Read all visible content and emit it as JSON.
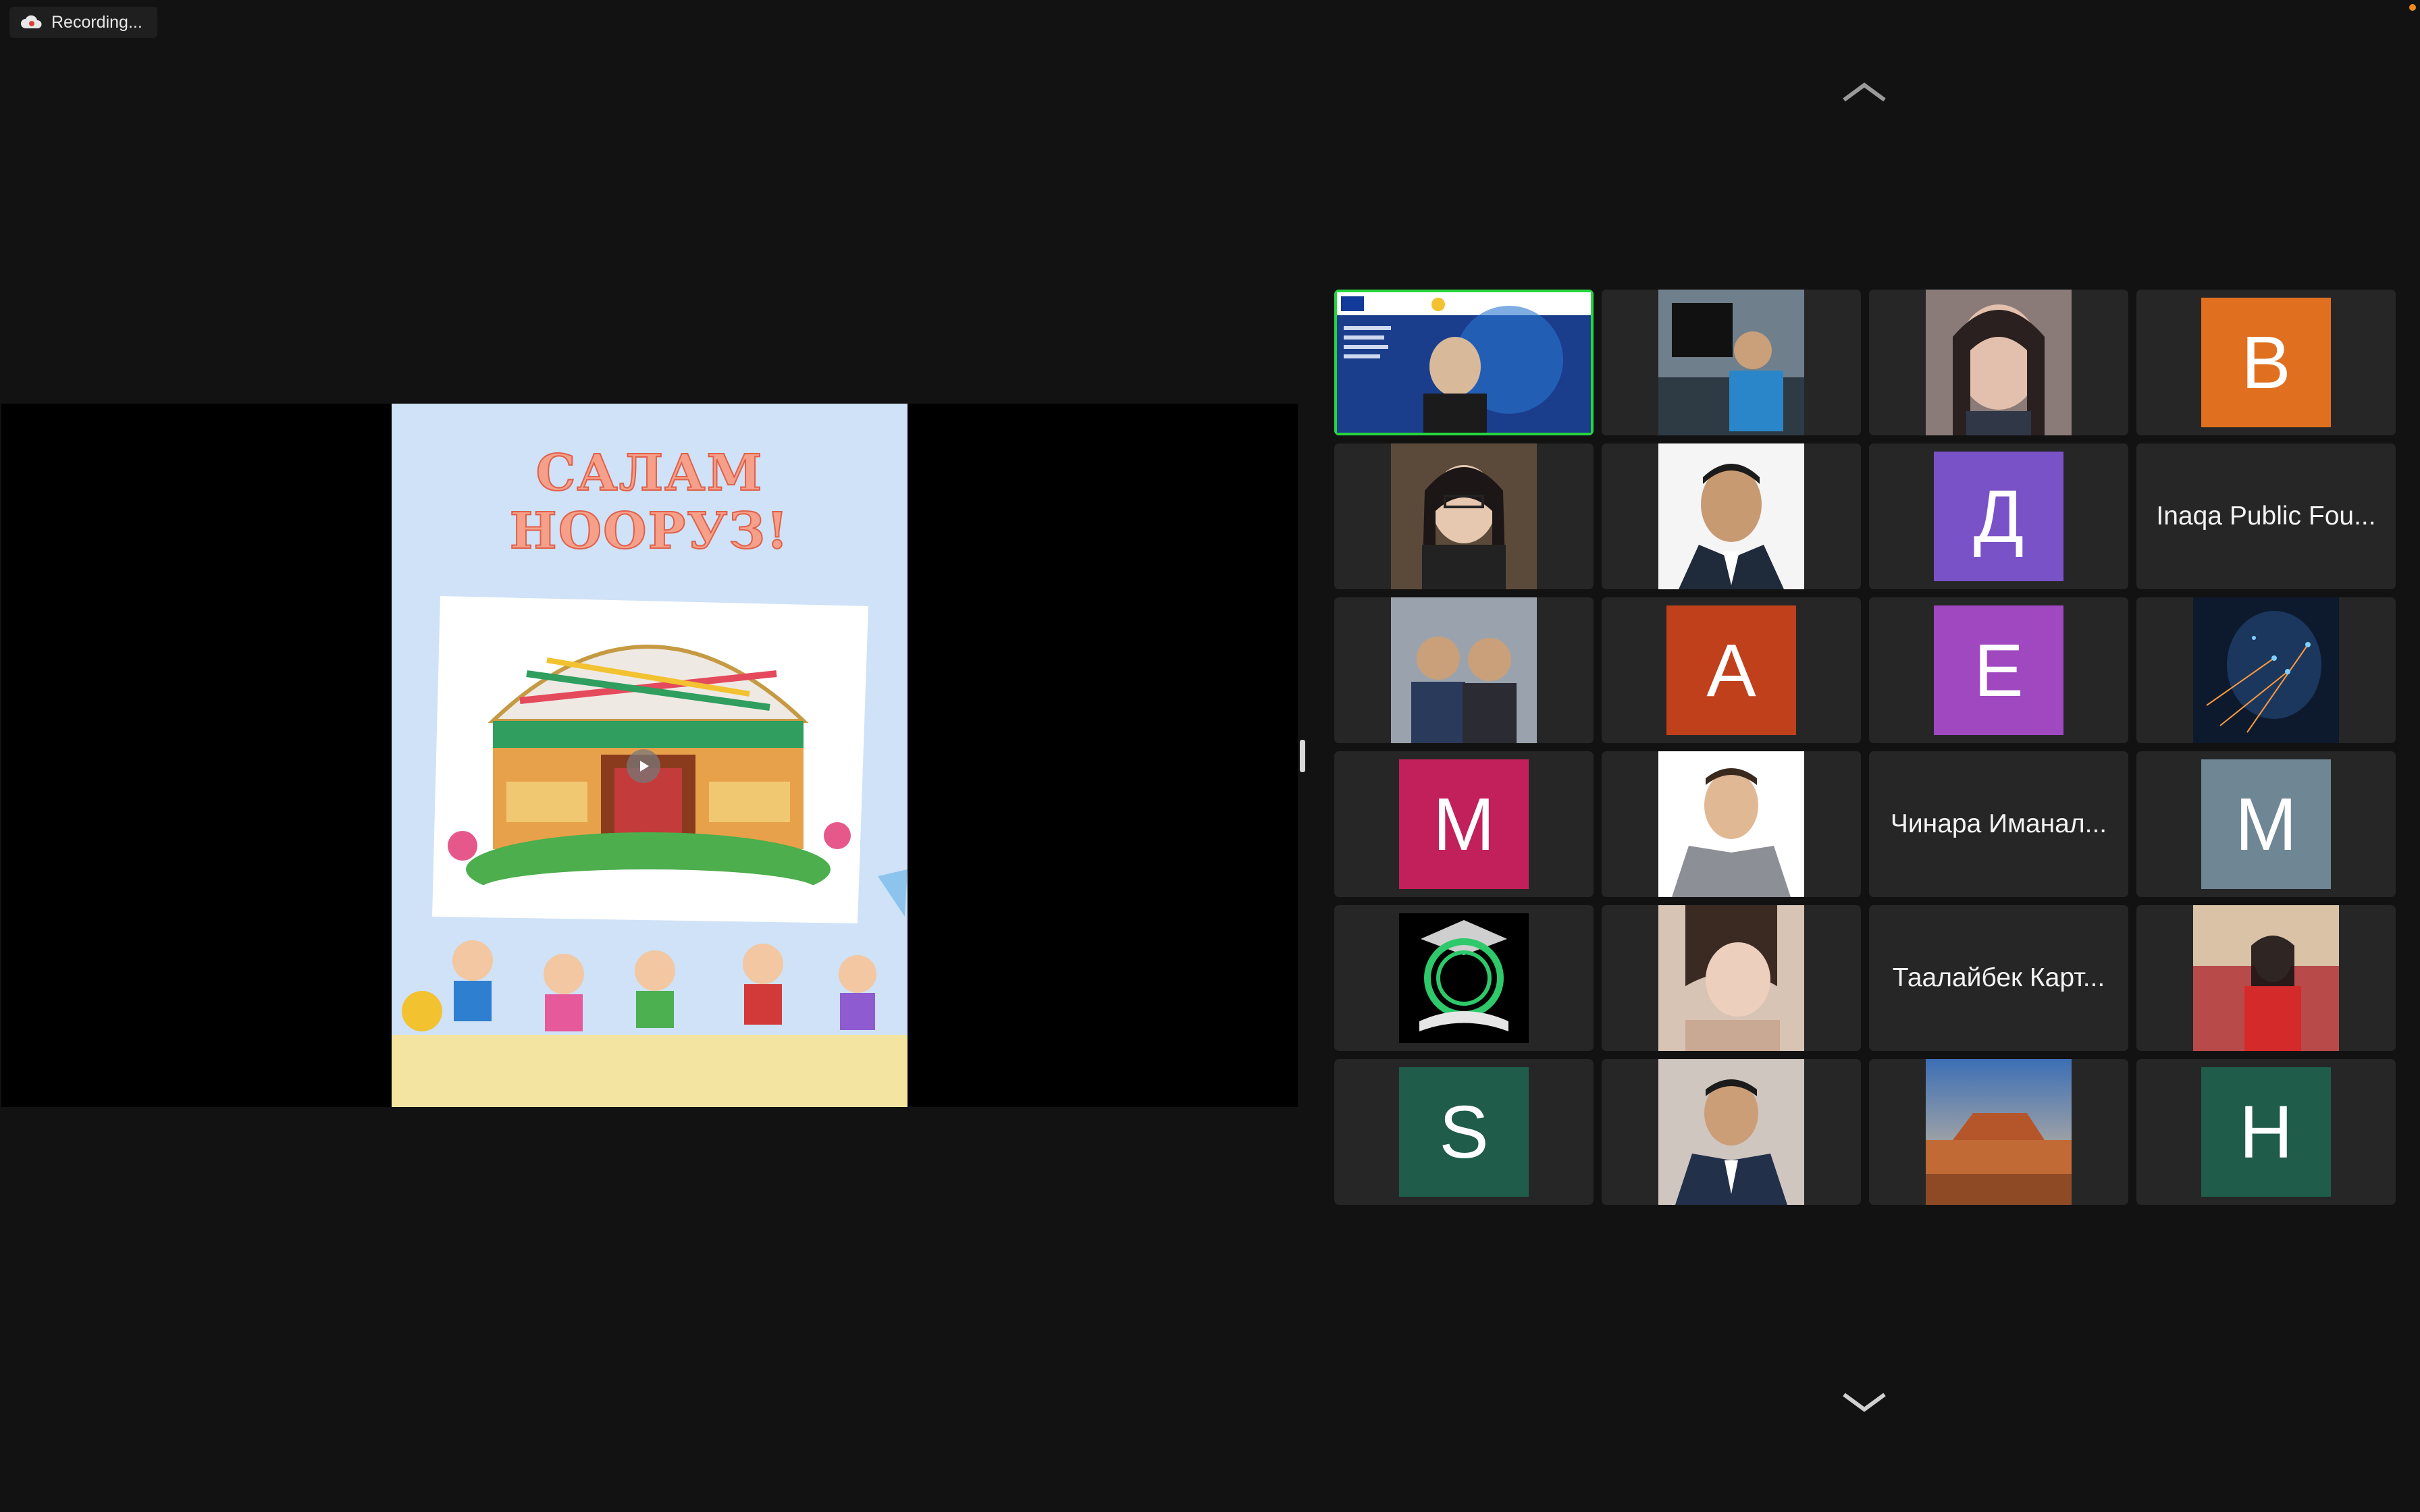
{
  "recording": {
    "label": "Recording...",
    "icon": "cloud-record-icon"
  },
  "navigation": {
    "up_icon": "chevron-up-icon",
    "down_icon": "chevron-down-icon"
  },
  "shared_screen": {
    "poster_title": "САЛАМ НООРУЗ!",
    "play_icon": "play-icon"
  },
  "colors": {
    "active_speaker_border": "#27d63d",
    "recording_dot": "#f08a1c",
    "background": "#121212",
    "tile": "#262626"
  },
  "participants": [
    {
      "kind": "video",
      "active": true,
      "image": "presentation-with-woman"
    },
    {
      "kind": "photo",
      "image": "man-at-computer"
    },
    {
      "kind": "photo",
      "image": "woman-portrait"
    },
    {
      "kind": "initial",
      "initial": "B",
      "color": "#e0701f"
    },
    {
      "kind": "photo",
      "image": "woman-with-glasses"
    },
    {
      "kind": "photo",
      "image": "man-in-suit"
    },
    {
      "kind": "initial",
      "initial": "Д",
      "color": "#7a52c7"
    },
    {
      "kind": "name",
      "name": "Inaqa Public Fou..."
    },
    {
      "kind": "photo",
      "image": "two-men"
    },
    {
      "kind": "initial",
      "initial": "A",
      "color": "#c0401c"
    },
    {
      "kind": "initial",
      "initial": "E",
      "color": "#a048c0"
    },
    {
      "kind": "photo",
      "image": "digital-network"
    },
    {
      "kind": "initial",
      "initial": "M",
      "color": "#c2205a"
    },
    {
      "kind": "photo",
      "image": "man-with-crossed-arms"
    },
    {
      "kind": "name",
      "name": "Чинара Иманал..."
    },
    {
      "kind": "initial",
      "initial": "M",
      "color": "#6f8694"
    },
    {
      "kind": "photo",
      "image": "npo-kg-logo"
    },
    {
      "kind": "photo",
      "image": "woman-selfie"
    },
    {
      "kind": "name",
      "name": "Таалайбек Карт..."
    },
    {
      "kind": "photo",
      "image": "woman-in-red"
    },
    {
      "kind": "initial",
      "initial": "S",
      "color": "#1f5c4a"
    },
    {
      "kind": "photo",
      "image": "man-in-jacket"
    },
    {
      "kind": "photo",
      "image": "desert-landscape"
    },
    {
      "kind": "initial",
      "initial": "H",
      "color": "#1f5c4a"
    }
  ]
}
